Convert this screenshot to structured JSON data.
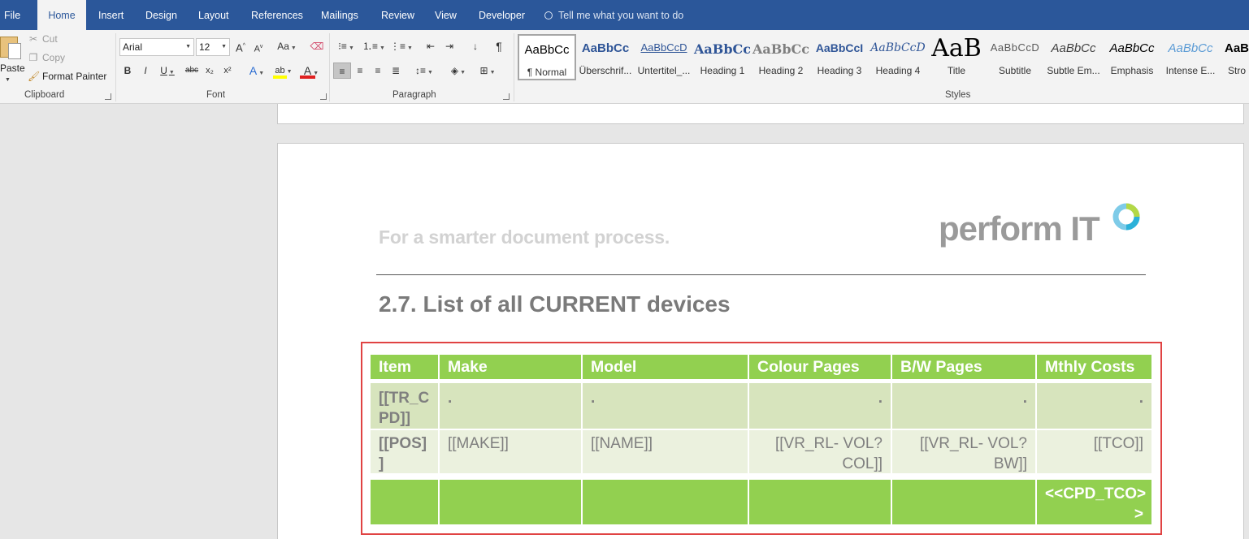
{
  "menu": {
    "tabs": [
      {
        "label": "File"
      },
      {
        "label": "Home"
      },
      {
        "label": "Insert"
      },
      {
        "label": "Design"
      },
      {
        "label": "Layout"
      },
      {
        "label": "References"
      },
      {
        "label": "Mailings"
      },
      {
        "label": "Review"
      },
      {
        "label": "View"
      },
      {
        "label": "Developer"
      }
    ],
    "active_tab": "Home",
    "tell_me": "Tell me what you want to do"
  },
  "ribbon": {
    "clipboard": {
      "label": "Clipboard",
      "paste": "Paste",
      "cut": "Cut",
      "copy": "Copy",
      "format_painter": "Format Painter"
    },
    "font": {
      "label": "Font",
      "name": "Arial",
      "size": "12",
      "grow": "A",
      "shrink": "A",
      "case": "Aa",
      "bold": "B",
      "italic": "I",
      "underline": "U",
      "strike": "abc",
      "sub": "x₂",
      "sup": "x²",
      "effects": "A",
      "highlight": "ab",
      "font_color": "A"
    },
    "paragraph": {
      "label": "Paragraph",
      "pilcrow": "¶"
    },
    "styles": {
      "label": "Styles",
      "items": [
        {
          "preview": "AaBbCc",
          "label": "¶ Normal"
        },
        {
          "preview": "AaBbCc",
          "label": "Überschrif..."
        },
        {
          "preview": "AaBbCcD",
          "label": "Untertitel_..."
        },
        {
          "preview": "AaBbCc",
          "label": "Heading 1"
        },
        {
          "preview": "AaBbCc",
          "label": "Heading 2"
        },
        {
          "preview": "AaBbCcI",
          "label": "Heading 3"
        },
        {
          "preview": "AaBbCcD",
          "label": "Heading 4"
        },
        {
          "preview": "AaB",
          "label": "Title"
        },
        {
          "preview": "AaBbCcD",
          "label": "Subtitle"
        },
        {
          "preview": "AaBbCc",
          "label": "Subtle Em..."
        },
        {
          "preview": "AaBbCc",
          "label": "Emphasis"
        },
        {
          "preview": "AaBbCc",
          "label": "Intense E..."
        },
        {
          "preview": "AaB",
          "label": "Stro"
        }
      ]
    }
  },
  "document": {
    "tagline": "For a smarter document process.",
    "logo": "perform IT",
    "heading": "2.7. List of all CURRENT devices",
    "table": {
      "headers": [
        "Item",
        "Make",
        "Model",
        "Colour Pages",
        "B/W Pages",
        "Mthly Costs"
      ],
      "row1": [
        "[[TR_C PD]]",
        ".",
        ".",
        ".",
        ".",
        "."
      ],
      "row2": [
        "[[POS] ]",
        "[[MAKE]]",
        "[[NAME]]",
        "[[VR_RL- VOL?COL]]",
        "[[VR_RL- VOL?BW]]",
        "[[TCO]]"
      ],
      "footer": [
        "",
        "",
        "",
        "",
        "",
        "<<CPD_TCO> >"
      ]
    }
  },
  "colors": {
    "menubar": "#2b579a",
    "table_header": "#92d050",
    "table_row1": "#d7e4bd",
    "table_row2": "#ebf1de",
    "highlight_box": "#e04343"
  }
}
